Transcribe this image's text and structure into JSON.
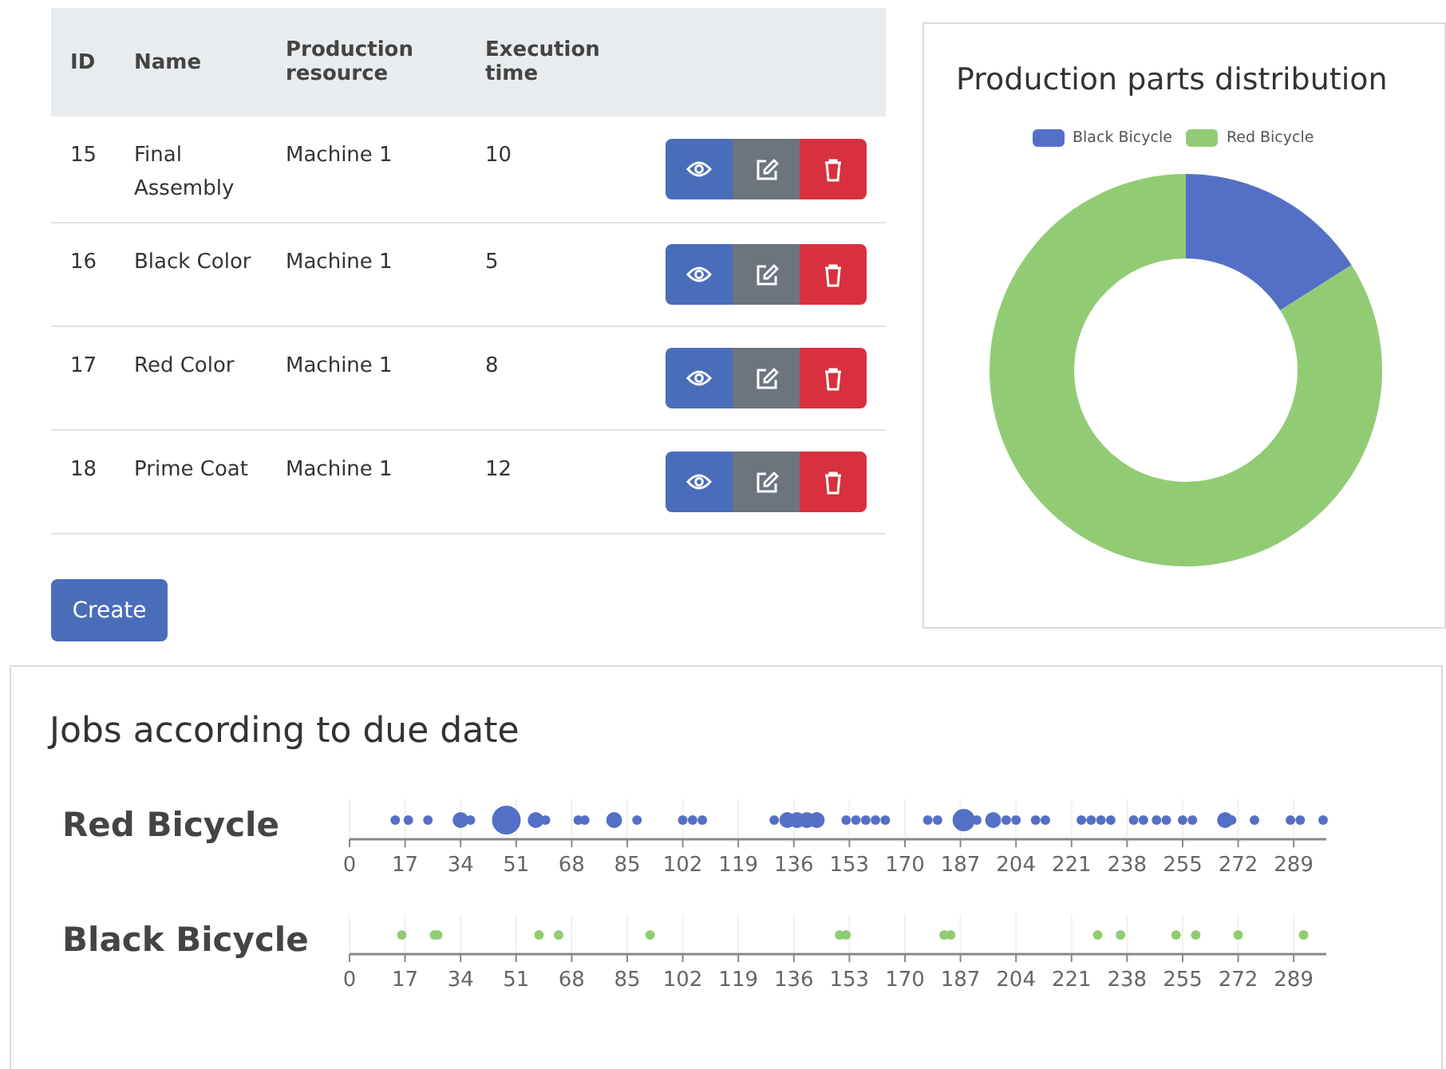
{
  "table": {
    "columns": [
      "ID",
      "Name",
      "Production resource",
      "Execution time"
    ],
    "rows": [
      {
        "id": "15",
        "name": "Final Assembly",
        "resource": "Machine 1",
        "time": "10"
      },
      {
        "id": "16",
        "name": "Black Color",
        "resource": "Machine 1",
        "time": "5"
      },
      {
        "id": "17",
        "name": "Red Color",
        "resource": "Machine 1",
        "time": "8"
      },
      {
        "id": "18",
        "name": "Prime Coat",
        "resource": "Machine 1",
        "time": "12"
      }
    ]
  },
  "create_button": "Create",
  "distribution": {
    "title": "Production parts distribution",
    "chart_data": {
      "type": "donut",
      "categories": [
        "Black Bicycle",
        "Red Bicycle"
      ],
      "series": [
        {
          "values": [
            16,
            84
          ]
        }
      ],
      "colors": [
        "#5470c6",
        "#91cc75"
      ]
    }
  },
  "jobs": {
    "title": "Jobs according to due date",
    "rows": [
      {
        "label": "Red Bicycle",
        "color": "#5470c6",
        "ticks": [
          "0",
          "17",
          "34",
          "51",
          "68",
          "85",
          "102",
          "119",
          "136",
          "153",
          "170",
          "187",
          "204",
          "221",
          "238",
          "255",
          "272",
          "289"
        ]
      },
      {
        "label": "Black Bicycle",
        "color": "#91cc75",
        "ticks": [
          "0",
          "17",
          "34",
          "51",
          "68",
          "85",
          "102",
          "119",
          "136",
          "153",
          "170",
          "187",
          "204",
          "221",
          "238",
          "255",
          "272",
          "289"
        ]
      }
    ]
  }
}
